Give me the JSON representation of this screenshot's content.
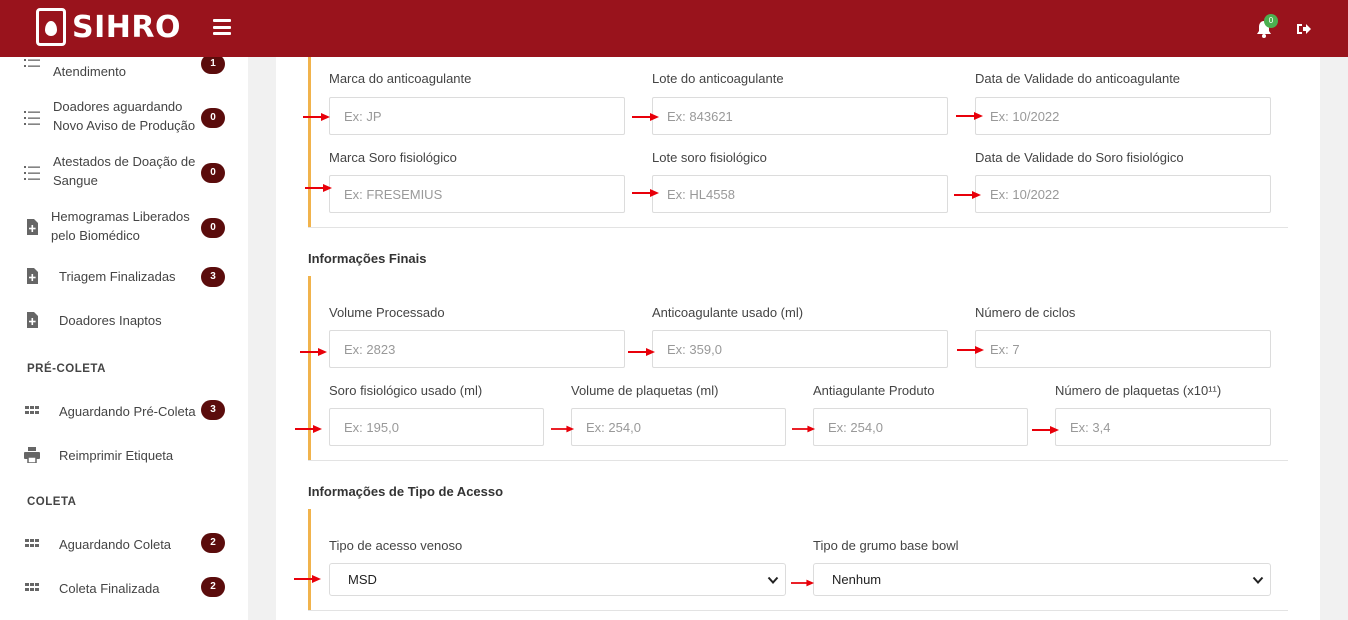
{
  "app": {
    "name": "SIHRO",
    "notification_count": "0"
  },
  "sidebar": {
    "items": [
      {
        "label_line1": "Atendimento",
        "label_line2": "",
        "badge": "1"
      },
      {
        "label_line1": "Doadores aguardando",
        "label_line2": "Novo Aviso de Produção",
        "badge": "0"
      },
      {
        "label_line1": "Atestados de Doação de",
        "label_line2": "Sangue",
        "badge": "0"
      },
      {
        "label_line1": "Hemogramas Liberados",
        "label_line2": "pelo Biomédico",
        "badge": "0"
      },
      {
        "label_line1": "Triagem Finalizadas",
        "label_line2": "",
        "badge": "3"
      },
      {
        "label_line1": "Doadores Inaptos",
        "label_line2": "",
        "badge": ""
      }
    ],
    "section_precoleta": "PRÉ-COLETA",
    "precoleta_items": [
      {
        "label": "Aguardando Pré-Coleta",
        "badge": "3"
      },
      {
        "label": "Reimprimir Etiqueta",
        "badge": ""
      }
    ],
    "section_coleta": "COLETA",
    "coleta_items": [
      {
        "label": "Aguardando Coleta",
        "badge": "2"
      },
      {
        "label": "Coleta Finalizada",
        "badge": "2"
      }
    ]
  },
  "form": {
    "anticoagulante": {
      "marca_label": "Marca do anticoagulante",
      "marca_placeholder": "Ex: JP",
      "lote_label": "Lote do anticoagulante",
      "lote_placeholder": "Ex: 843621",
      "validade_label": "Data de Validade do anticoagulante",
      "validade_placeholder": "Ex: 10/2022"
    },
    "soro": {
      "marca_label": "Marca Soro fisiológico",
      "marca_placeholder": "Ex: FRESEMIUS",
      "lote_label": "Lote soro fisiológico",
      "lote_placeholder": "Ex: HL4558",
      "validade_label": "Data de Validade do Soro fisiológico",
      "validade_placeholder": "Ex: 10/2022"
    },
    "finais": {
      "title": "Informações Finais",
      "volume_label": "Volume Processado",
      "volume_placeholder": "Ex: 2823",
      "anticoag_label": "Anticoagulante usado (ml)",
      "anticoag_placeholder": "Ex: 359,0",
      "ciclos_label": "Número de ciclos",
      "ciclos_placeholder": "Ex: 7",
      "soro_label": "Soro fisiológico usado (ml)",
      "soro_placeholder": "Ex: 195,0",
      "plaquetas_vol_label": "Volume de plaquetas (ml)",
      "plaquetas_vol_placeholder": "Ex: 254,0",
      "antiag_label": "Antiagulante Produto",
      "antiag_placeholder": "Ex: 254,0",
      "plaquetas_num_label": "Número de plaquetas (x10¹¹)",
      "plaquetas_num_placeholder": "Ex: 3,4"
    },
    "acesso": {
      "title": "Informações de Tipo de Acesso",
      "venoso_label": "Tipo de acesso venoso",
      "venoso_value": "MSD",
      "grumo_label": "Tipo de grumo base bowl",
      "grumo_value": "Nenhum"
    }
  },
  "colors": {
    "topbar": "#99131c",
    "accent_bar": "#f1b34c",
    "badge": "#5b0c0c",
    "arrow": "#e8000a"
  }
}
